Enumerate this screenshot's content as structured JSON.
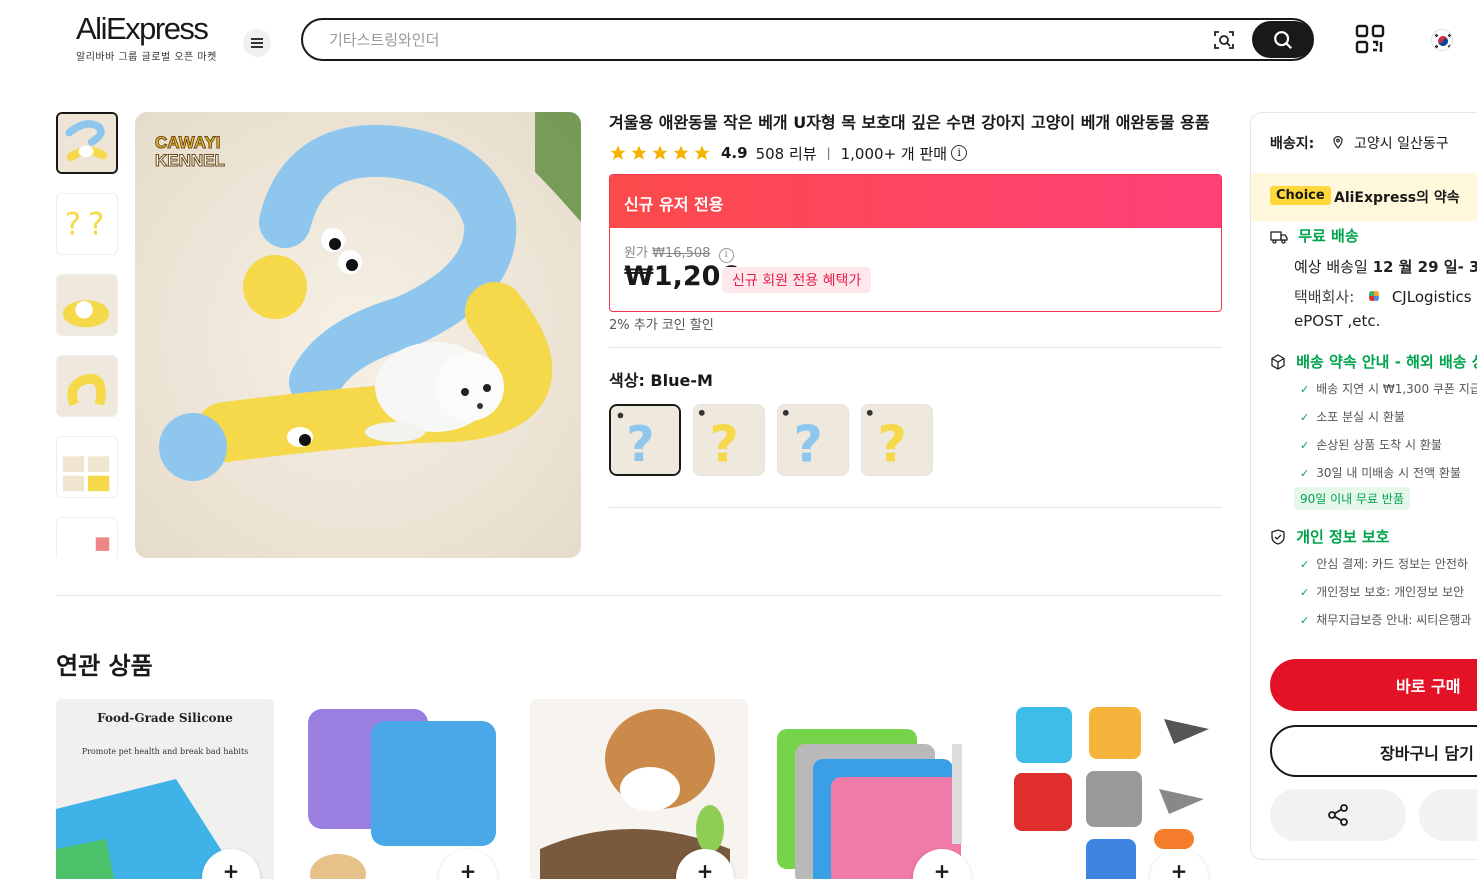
{
  "header": {
    "logo_text": "AliExpress",
    "logo_sub": "알리바바 그룹 글로벌 오픈 마켓",
    "search_placeholder": "기타스트링와인더"
  },
  "product": {
    "title": "겨울용 애완동물 작은 베개 U자형 목 보호대 깊은 수면 강아지 고양이 베개 애완동물 용품",
    "rating": "4.9",
    "stars": 5,
    "reviews": "508 리뷰",
    "sold": "1,000+ 개 판매",
    "image_brand_line1": "CAWAYI",
    "image_brand_line2": "KENNEL",
    "promo_header": "신규 유저 전용",
    "original_label": "원가",
    "original_price": "₩16,508",
    "price": "₩1,206",
    "promo_tag": "신규 회원 전용 혜택가",
    "coin_discount": "2% 추가 코인 할인",
    "color_label": "색상: Blue-M",
    "swatch_count": 4,
    "thumbnail_count": 6
  },
  "related": {
    "title": "연관 상품",
    "card1_heading": "Food-Grade Silicone",
    "card1_sub": "Promote pet health and break bad habits",
    "cart_glyph": "+"
  },
  "side": {
    "ship_label": "배송지:",
    "ship_address": "고양시 일산동구",
    "choice_badge": "Choice",
    "choice_title": "AliExpress의 약속",
    "free_shipping": "무료 배송",
    "eta_prefix": "예상 배송일",
    "eta_date": "12 월 29 일- 3",
    "courier_label": "택배회사:",
    "courier_name": "CJLogistics",
    "courier_more": "ePOST ,etc.",
    "promise_head": "배송 약속 안내 - 해외 배송 상",
    "promises": [
      "배송 지연 시 ₩1,300 쿠폰 지급",
      "소포 분실 시 환불",
      "손상된 상품 도착 시 환불",
      "30일 내 미배송 시 전액 환불"
    ],
    "return_pill": "90일 이내 무료 반품",
    "privacy_head": "개인 정보 보호",
    "privacy": [
      "안심 결제: 카드 정보는 안전하",
      "개인정보 보호: 개인정보 보안",
      "채무지급보증 안내: 씨티은행과"
    ],
    "buy_now": "바로 구매",
    "add_cart": "장바구니 담기"
  },
  "colors": {
    "accent_red": "#e31226",
    "promo_gradient_start": "#fb4a4a",
    "promo_gradient_end": "#ff3f78",
    "green": "#00a34c",
    "star": "#f5b400"
  }
}
